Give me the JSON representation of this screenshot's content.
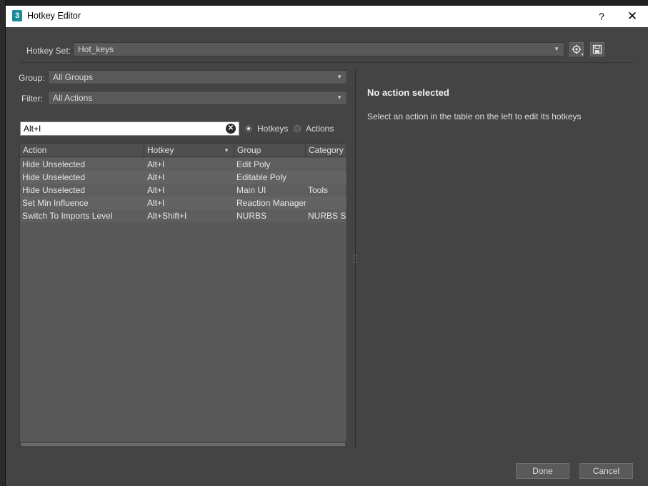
{
  "window": {
    "app_icon_glyph": "3",
    "title": "Hotkey Editor",
    "help_glyph": "?",
    "close_glyph": "✕"
  },
  "hotkey_set": {
    "label": "Hotkey Set:",
    "value": "Hot_keys"
  },
  "group": {
    "label": "Group:",
    "value": "All Groups"
  },
  "filter": {
    "label": "Filter:",
    "value": "All Actions"
  },
  "search": {
    "value": "Alt+I"
  },
  "search_mode": {
    "options": [
      "Hotkeys",
      "Actions"
    ],
    "selected": "Hotkeys"
  },
  "table": {
    "columns": [
      "Action",
      "Hotkey",
      "Group",
      "Category"
    ],
    "rows": [
      [
        "Hide Unselected",
        "Alt+I",
        "Edit Poly",
        ""
      ],
      [
        "Hide Unselected",
        "Alt+I",
        "Editable Poly",
        ""
      ],
      [
        "Hide Unselected",
        "Alt+I",
        "Main UI",
        "Tools"
      ],
      [
        "Set Min Influence",
        "Alt+I",
        "Reaction Manager",
        ""
      ],
      [
        "Switch To Imports Level",
        "Alt+Shift+I",
        "NURBS",
        "NURBS Sur..."
      ]
    ]
  },
  "detail": {
    "heading": "No action selected",
    "hint": "Select an action in the table on the left to edit its hotkeys"
  },
  "buttons": {
    "done": "Done",
    "cancel": "Cancel"
  },
  "icons": {
    "settings": "gear-icon",
    "save": "floppy-disk-icon",
    "clear": "clear-x-icon",
    "dropdown": "chevron-down-icon"
  }
}
